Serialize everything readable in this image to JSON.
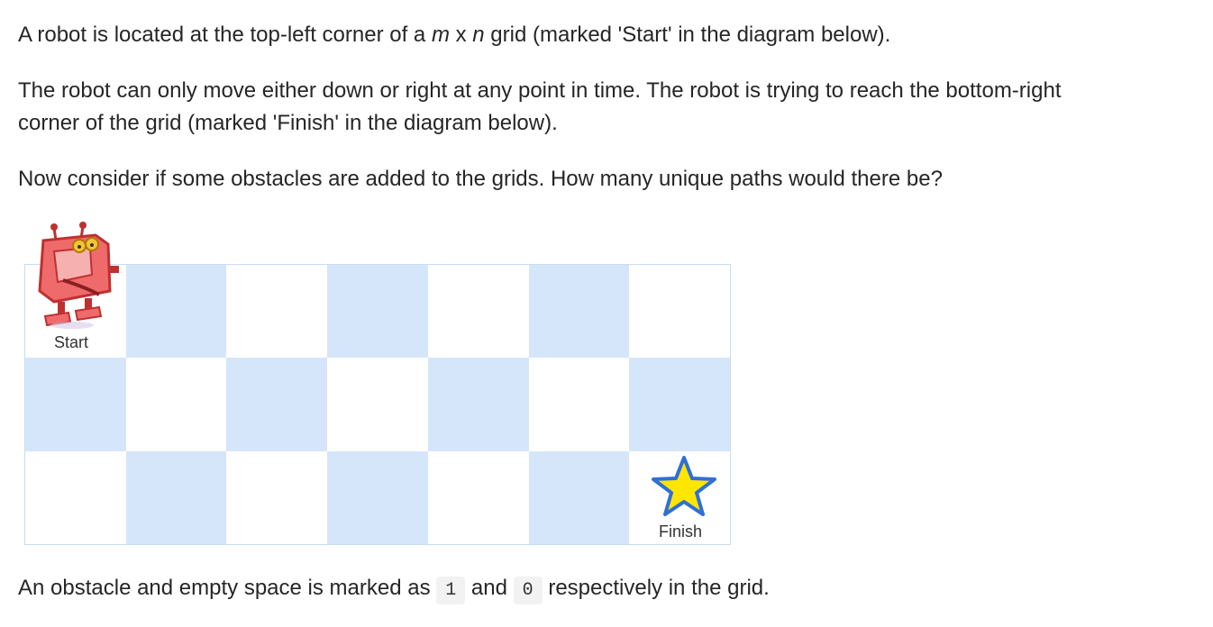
{
  "paragraphs": {
    "p1": {
      "prefix": "A robot is located at the top-left corner of a ",
      "m": "m",
      "mid": " x ",
      "n": "n",
      "suffix": " grid (marked 'Start' in the diagram below)."
    },
    "p2_line1": "The robot can only move either down or right at any point in time. The robot is trying to reach the bottom-right",
    "p2_line2": "corner of the grid (marked 'Finish' in the diagram below).",
    "p3": "Now consider if some obstacles are added to the grids. How many unique paths would there be?",
    "p4": {
      "prefix": "An obstacle and empty space is marked as ",
      "code1": "1",
      "and": " and ",
      "code0": "0",
      "suffix": " respectively in the grid."
    }
  },
  "diagram": {
    "rows": 3,
    "cols": 7,
    "start_label": "Start",
    "finish_label": "Finish",
    "colors": {
      "light_cell": "#d6e6fa",
      "white_cell": "#ffffff",
      "robot_body": "#ef6b6b",
      "star_fill": "#ffe600",
      "star_stroke": "#2f6fd6"
    }
  }
}
